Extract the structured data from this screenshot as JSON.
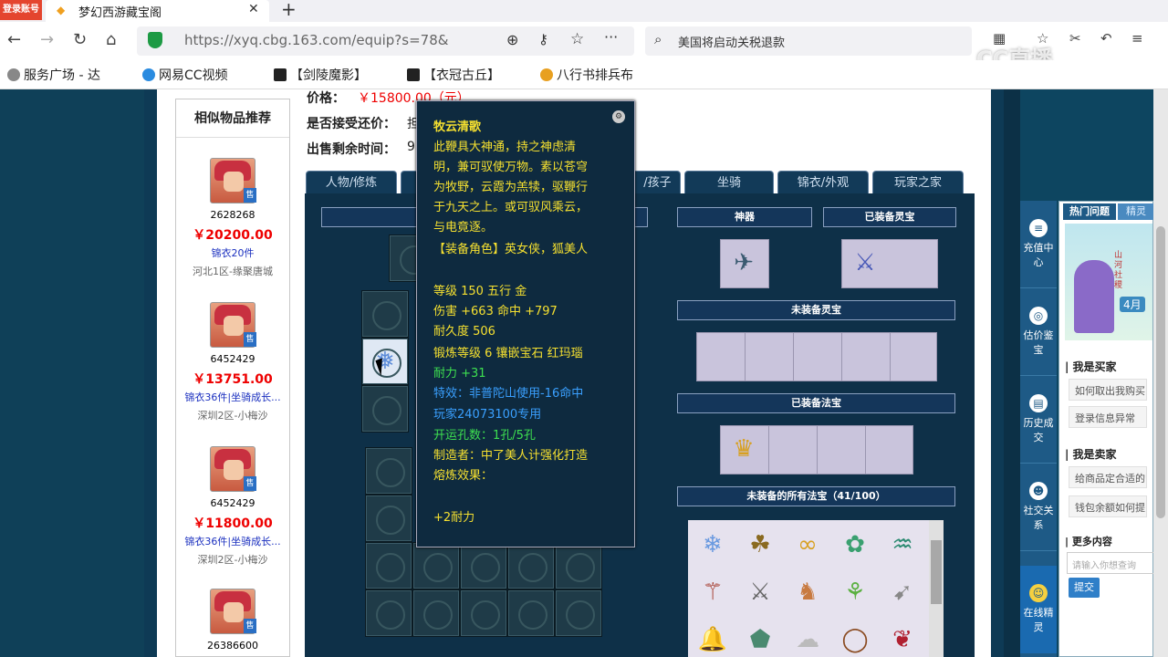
{
  "browser": {
    "login_badge": "登录账号",
    "tab_title": "梦幻西游藏宝阁",
    "url": "https://xyq.cbg.163.com/equip?s=78&",
    "search_text": "美国将启动关税退款",
    "watermark": "CC直播"
  },
  "bookmarks": [
    "服务广场 - 达",
    "网易CC视频",
    "【剑陵魔影】",
    "【衣冠古丘】",
    "八行书排兵布"
  ],
  "similar": {
    "title": "相似物品推荐",
    "items": [
      {
        "id": "2628268",
        "price": "￥20200.00",
        "desc": "锦衣20件",
        "server": "河北1区-缘聚唐城"
      },
      {
        "id": "6452429",
        "price": "￥13751.00",
        "desc": "锦衣36件|坐骑成长...",
        "server": "深圳2区-小梅沙"
      },
      {
        "id": "6452429",
        "price": "￥11800.00",
        "desc": "锦衣36件|坐骑成长...",
        "server": "深圳2区-小梅沙"
      },
      {
        "id": "26386600",
        "price": "",
        "desc": "",
        "server": ""
      }
    ],
    "sale_badge": "售"
  },
  "listing": {
    "price_label": "价格：",
    "price_value": "￥15800.00（元）",
    "bargain_label": "是否接受还价：",
    "bargain_value": "担",
    "time_label": "出售剩余时间：",
    "time_value": "9"
  },
  "tabs": [
    "人物/修炼",
    "",
    "/孩子",
    "坐骑",
    "锦衣/外观",
    "玩家之家"
  ],
  "sections": {
    "shenqi": "神器",
    "equipped_lingbao": "已装备灵宝",
    "unequipped_lingbao": "未装备灵宝",
    "equipped_fabao": "已装备法宝",
    "all_fabao": "未装备的所有法宝（41/100）"
  },
  "tooltip": {
    "name": "牧云清歌",
    "desc": [
      "此鞭具大神通，持之神虑清",
      "明，兼可驭使万物。素以苍穹",
      "为牧野，云霞为羔犊，驱鞭行",
      "于九天之上。或可驭风乘云，",
      "与电竟逐。"
    ],
    "role": "【装备角色】英女侠，狐美人",
    "level": "等级 150  五行 金",
    "damage": "伤害 +663  命中 +797",
    "durability": "耐久度 506",
    "forge": "锻炼等级 6  镶嵌宝石 红玛瑙",
    "naili": "耐力 +31",
    "special": "特效：非普陀山使用-16命中",
    "owner": "玩家24073100专用",
    "holes": "开运孔数：1孔/5孔",
    "maker": "制造者：中了美人计强化打造",
    "melt": "熔炼效果：",
    "bonus": "+2耐力"
  },
  "dock": [
    {
      "label": "充值中心",
      "icon": "≡"
    },
    {
      "label": "估价鉴宝",
      "icon": "◎"
    },
    {
      "label": "历史成交",
      "icon": "▤"
    },
    {
      "label": "社交关系",
      "icon": "☻"
    },
    {
      "label": "在线精灵",
      "icon": "☺"
    }
  ],
  "help": {
    "tab_hot": "热门问题",
    "tab_other": "精灵",
    "banner_text": "山河社稷",
    "banner_month": "4月",
    "buyer_heading": "| 我是买家",
    "buyer_q": [
      "如何取出我购买",
      "登录信息异常"
    ],
    "seller_heading": "| 我是卖家",
    "seller_q": [
      "给商品定合适的",
      "钱包余额如何提"
    ],
    "more_heading": "| 更多内容",
    "input_placeholder": "请输入你想查询",
    "submit": "提交"
  }
}
